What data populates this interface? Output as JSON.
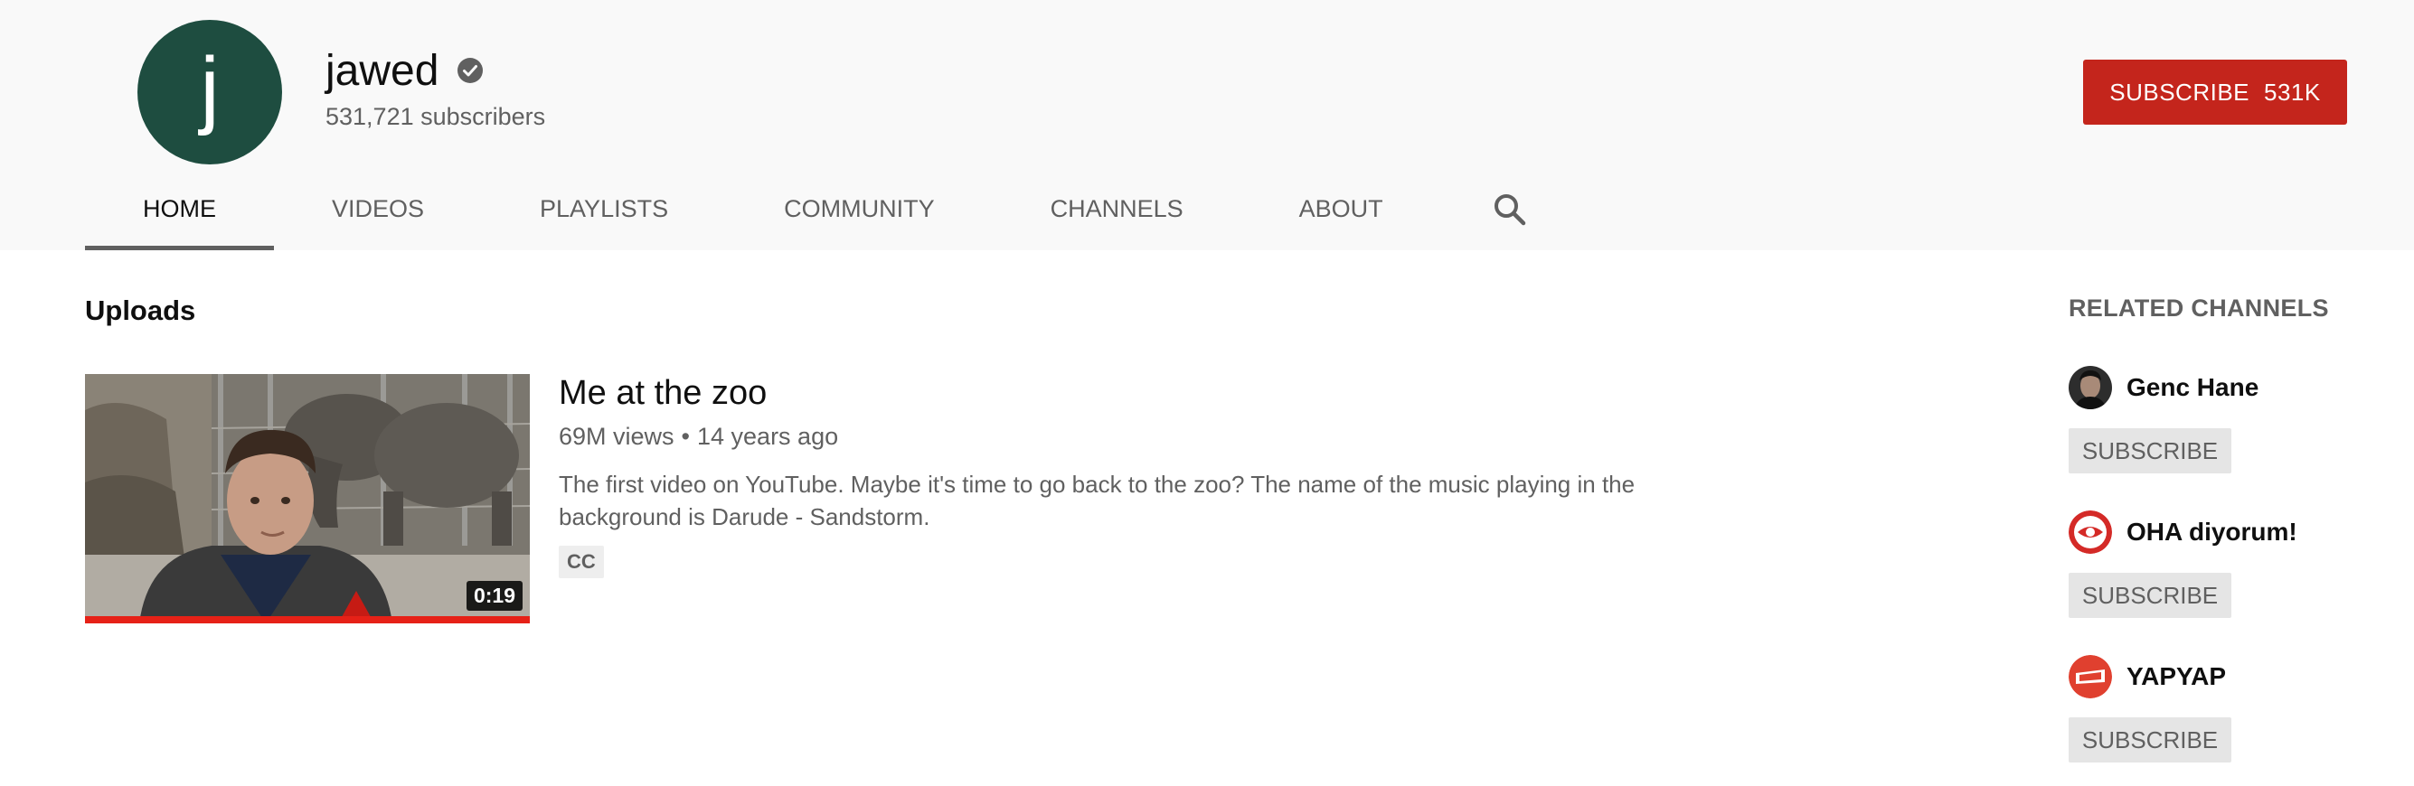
{
  "channel": {
    "avatar_letter": "j",
    "name": "jawed",
    "subscribers": "531,721 subscribers",
    "subscribe_label": "SUBSCRIBE",
    "subscribe_count": "531K",
    "avatar_color": "#1e4d40",
    "verified_icon": "verified-check-icon"
  },
  "tabs": [
    {
      "label": "HOME",
      "active": true
    },
    {
      "label": "VIDEOS"
    },
    {
      "label": "PLAYLISTS"
    },
    {
      "label": "COMMUNITY"
    },
    {
      "label": "CHANNELS"
    },
    {
      "label": "ABOUT"
    }
  ],
  "tab_search_icon": "search-icon",
  "uploads": {
    "title": "Uploads",
    "video": {
      "title": "Me at the zoo",
      "views": "69M views",
      "separator": "•",
      "age": "14 years ago",
      "description": "The first video on YouTube. Maybe it's time to go back to the zoo? The name of the music playing in the background is Darude - Sandstorm.",
      "badge": "CC",
      "duration": "0:19",
      "watched_progress": 1.0
    }
  },
  "related": {
    "title": "RELATED CHANNELS",
    "channels": [
      {
        "name": "Genc Hane",
        "subscribe_label": "SUBSCRIBE"
      },
      {
        "name": "OHA diyorum!",
        "subscribe_label": "SUBSCRIBE"
      },
      {
        "name": "YAPYAP",
        "subscribe_label": "SUBSCRIBE"
      }
    ]
  },
  "colors": {
    "subscribe_red": "#c4251c",
    "header_bg": "#f9f9f9",
    "progress_red": "#e62117"
  }
}
